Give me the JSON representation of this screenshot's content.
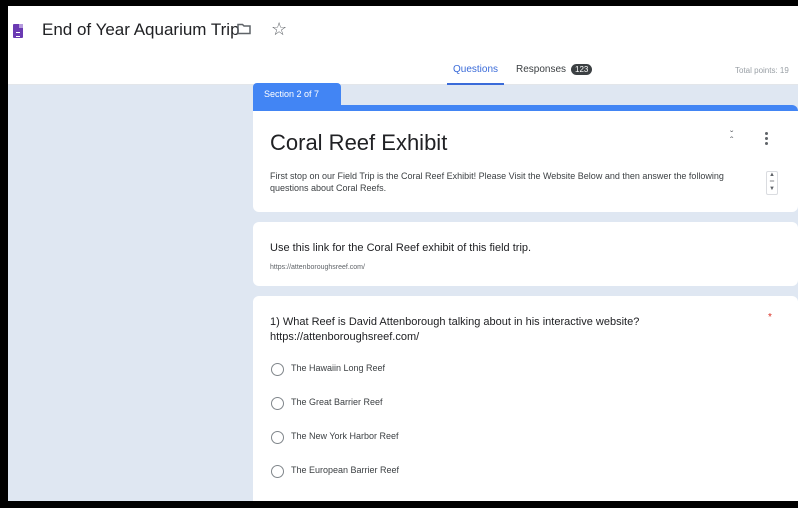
{
  "header": {
    "title": "End of Year Aquarium Trip",
    "icons": [
      "google-forms-icon",
      "folder-icon",
      "star-icon"
    ]
  },
  "tabs": {
    "questions": "Questions",
    "responses": "Responses",
    "responses_count": "123",
    "total_points": "Total points: 19"
  },
  "section": {
    "label": "Section 2 of 7",
    "title": "Coral Reef Exhibit",
    "description": "First stop on our Field Trip is the Coral Reef Exhibit! Please Visit the Website Below and then answer the following questions about Coral Reefs."
  },
  "link_card": {
    "heading": "Use this link for the Coral Reef exhibit of this field trip.",
    "url": "https://attenboroughsreef.com/"
  },
  "question": {
    "text": "1) What Reef is David Attenborough talking about in his interactive website? https://attenboroughsreef.com/",
    "required": "*",
    "options": [
      "The Hawaiin Long Reef",
      "The Great Barrier Reef",
      "The New York Harbor Reef",
      "The European Barrier Reef"
    ]
  },
  "colors": {
    "accent": "#4285f4",
    "tab_active": "#3a6bd9",
    "background": "#dfe7f2",
    "form_icon": "#6a3ab2",
    "required": "#d93025"
  }
}
